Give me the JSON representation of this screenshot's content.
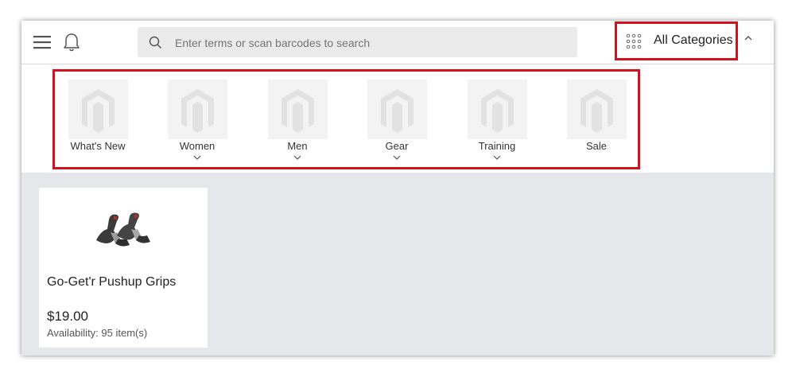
{
  "header": {
    "search_placeholder": "Enter terms or scan barcodes to search",
    "category_selector_label": "All Categories"
  },
  "categories": [
    {
      "label": "What's New",
      "has_submenu": false,
      "icon": "magento-logo"
    },
    {
      "label": "Women",
      "has_submenu": true,
      "icon": "magento-logo"
    },
    {
      "label": "Men",
      "has_submenu": true,
      "icon": "magento-logo"
    },
    {
      "label": "Gear",
      "has_submenu": true,
      "icon": "magento-logo"
    },
    {
      "label": "Training",
      "has_submenu": true,
      "icon": "magento-logo"
    },
    {
      "label": "Sale",
      "has_submenu": false,
      "icon": "magento-logo"
    }
  ],
  "products": [
    {
      "name": "Go-Get'r Pushup Grips",
      "price": "$19.00",
      "availability_label": "Availability:",
      "availability_value": "95 item(s)"
    }
  ],
  "colors": {
    "highlight_border": "#d0121f",
    "product_area_bg": "#e5e7eb",
    "search_bg": "#ebebeb"
  }
}
